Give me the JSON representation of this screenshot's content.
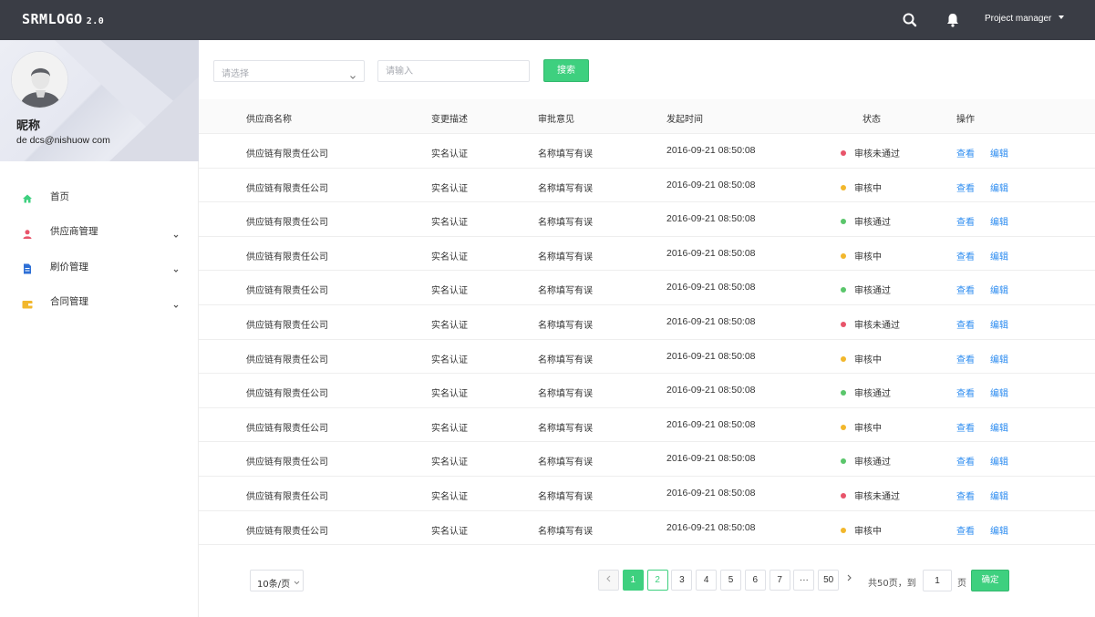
{
  "header": {
    "logo": "SRMLOGO",
    "version": "2.0",
    "user_menu": "Project manager",
    "icons": [
      "search-icon",
      "bell-icon",
      "chevron-down-icon"
    ]
  },
  "profile": {
    "nickname": "昵称",
    "email": "de dcs@nishuow com"
  },
  "sidebar": {
    "items": [
      {
        "label": "首页",
        "icon": "home-icon",
        "color": "#3ed07f"
      },
      {
        "label": "供应商管理",
        "icon": "user-icon",
        "color": "#e8546a"
      },
      {
        "label": "刷价管理",
        "icon": "document-icon",
        "color": "#2d6fd6"
      },
      {
        "label": "合同管理",
        "icon": "wallet-icon",
        "color": "#f2b72c"
      }
    ]
  },
  "filters": {
    "select_placeholder": "请选择",
    "input_placeholder": "请输入",
    "search_label": "搜索"
  },
  "table": {
    "headers": [
      "供应商名称",
      "变更描述",
      "审批意见",
      "发起时间",
      "状态",
      "操作"
    ],
    "view_label": "查看",
    "edit_label": "编辑",
    "rows": [
      {
        "name": "供应链有限责任公司",
        "desc": "实名认证",
        "opinion": "名称填写有误",
        "time": "2016-09-21  08:50:08",
        "status": "审核未通过",
        "status_color": "#e8546a"
      },
      {
        "name": "供应链有限责任公司",
        "desc": "实名认证",
        "opinion": "名称填写有误",
        "time": "2016-09-21  08:50:08",
        "status": "审核中",
        "status_color": "#f2b72c"
      },
      {
        "name": "供应链有限责任公司",
        "desc": "实名认证",
        "opinion": "名称填写有误",
        "time": "2016-09-21  08:50:08",
        "status": "审核通过",
        "status_color": "#5ac66b"
      },
      {
        "name": "供应链有限责任公司",
        "desc": "实名认证",
        "opinion": "名称填写有误",
        "time": "2016-09-21  08:50:08",
        "status": "审核中",
        "status_color": "#f2b72c"
      },
      {
        "name": "供应链有限责任公司",
        "desc": "实名认证",
        "opinion": "名称填写有误",
        "time": "2016-09-21  08:50:08",
        "status": "审核通过",
        "status_color": "#5ac66b"
      },
      {
        "name": "供应链有限责任公司",
        "desc": "实名认证",
        "opinion": "名称填写有误",
        "time": "2016-09-21  08:50:08",
        "status": "审核未通过",
        "status_color": "#e8546a"
      },
      {
        "name": "供应链有限责任公司",
        "desc": "实名认证",
        "opinion": "名称填写有误",
        "time": "2016-09-21  08:50:08",
        "status": "审核中",
        "status_color": "#f2b72c"
      },
      {
        "name": "供应链有限责任公司",
        "desc": "实名认证",
        "opinion": "名称填写有误",
        "time": "2016-09-21  08:50:08",
        "status": "审核通过",
        "status_color": "#5ac66b"
      },
      {
        "name": "供应链有限责任公司",
        "desc": "实名认证",
        "opinion": "名称填写有误",
        "time": "2016-09-21  08:50:08",
        "status": "审核中",
        "status_color": "#f2b72c"
      },
      {
        "name": "供应链有限责任公司",
        "desc": "实名认证",
        "opinion": "名称填写有误",
        "time": "2016-09-21  08:50:08",
        "status": "审核通过",
        "status_color": "#5ac66b"
      },
      {
        "name": "供应链有限责任公司",
        "desc": "实名认证",
        "opinion": "名称填写有误",
        "time": "2016-09-21  08:50:08",
        "status": "审核未通过",
        "status_color": "#e8546a"
      },
      {
        "name": "供应链有限责任公司",
        "desc": "实名认证",
        "opinion": "名称填写有误",
        "time": "2016-09-21  08:50:08",
        "status": "审核中",
        "status_color": "#f2b72c"
      }
    ]
  },
  "pagination": {
    "page_size": "10条/页",
    "pages": [
      "1",
      "2",
      "3",
      "4",
      "5",
      "6",
      "7",
      "···",
      "50"
    ],
    "current_page": "1",
    "total_text": "共50页，到",
    "goto_value": "1",
    "unit": "页",
    "confirm_label": "确定"
  },
  "colors": {
    "accent": "#3ed07f",
    "link": "#2d8cf0",
    "topbar": "#3a3d45"
  }
}
